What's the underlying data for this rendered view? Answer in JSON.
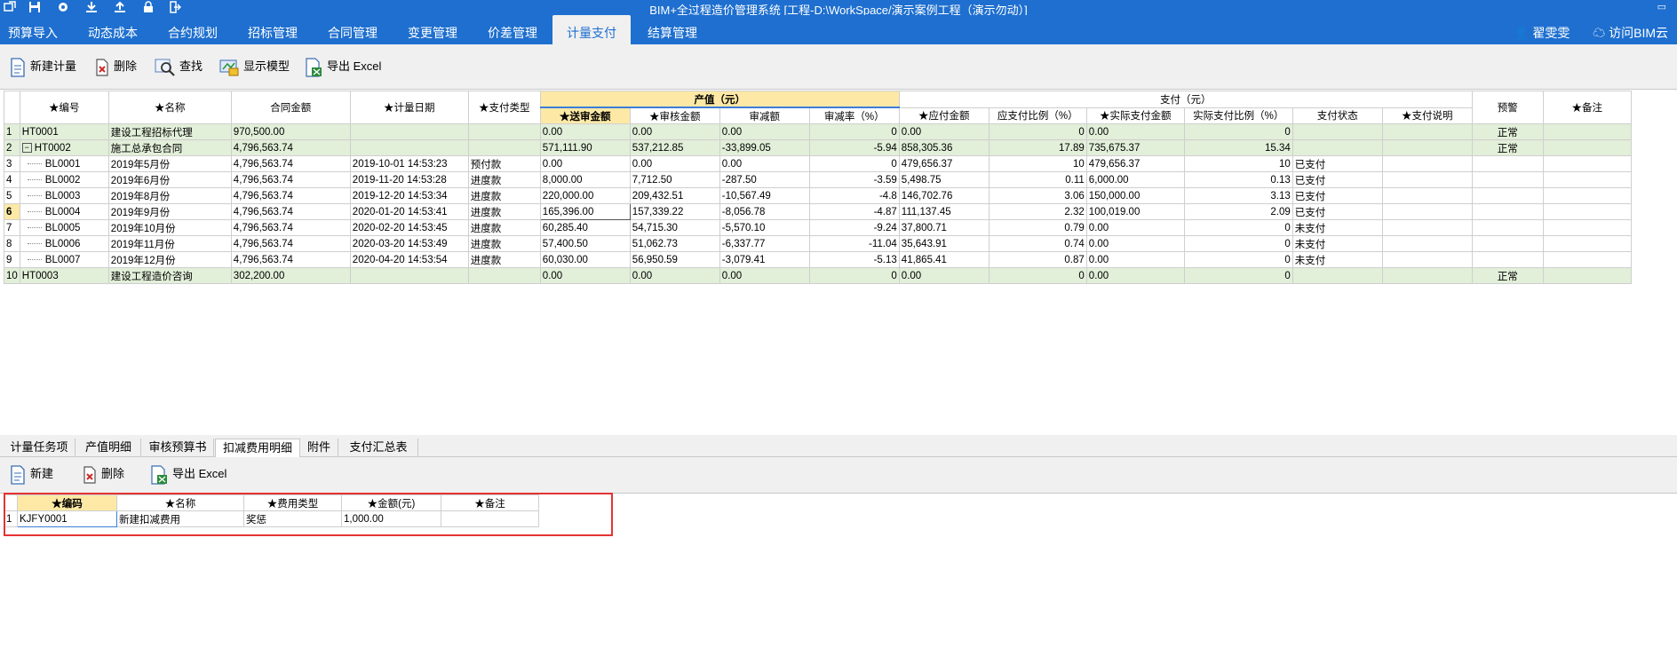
{
  "app": {
    "title": "BIM+全过程造价管理系统 [工程-D:\\WorkSpace/演示案例工程（演示勿动）]",
    "window_restore": "▭",
    "user_name": "翟雯雯",
    "cloud_link": "访问BIM云"
  },
  "menu": [
    {
      "label": "预算导入"
    },
    {
      "label": "动态成本"
    },
    {
      "label": "合约规划"
    },
    {
      "label": "招标管理"
    },
    {
      "label": "合同管理"
    },
    {
      "label": "变更管理"
    },
    {
      "label": "价差管理"
    },
    {
      "label": "计量支付"
    },
    {
      "label": "结算管理"
    }
  ],
  "toolbar": {
    "new_plan": "新建计量",
    "delete": "删除",
    "find": "查找",
    "show_model": "显示模型",
    "export_excel": "导出 Excel"
  },
  "main_table": {
    "group_output": "产值（元）",
    "group_payment": "支付（元）",
    "headers": [
      "★编号",
      "★名称",
      "合同金额",
      "★计量日期",
      "★支付类型",
      "★送审金额",
      "★审核金额",
      "审减额",
      "审减率（%）",
      "★应付金额",
      "应支付比例（%）",
      "★实际支付金额",
      "实际支付比例（%）",
      "支付状态",
      "★支付说明",
      "预警",
      "★备注"
    ],
    "rows": [
      {
        "n": "1",
        "code": "HT0001",
        "name": "建设工程招标代理",
        "amount": "970,500.00",
        "date": "",
        "type": "",
        "submit": "0.00",
        "audit": "0.00",
        "cut": "0.00",
        "rate": "0",
        "payable": "0.00",
        "pratio": "0",
        "actual": "0.00",
        "aratio": "0",
        "status": "",
        "note": "",
        "warn": "正常",
        "remark": ""
      },
      {
        "n": "2",
        "code": "HT0002",
        "name": "施工总承包合同",
        "amount": "4,796,563.74",
        "date": "",
        "type": "",
        "submit": "571,111.90",
        "audit": "537,212.85",
        "cut": "-33,899.05",
        "rate": "-5.94",
        "payable": "858,305.36",
        "pratio": "17.89",
        "actual": "735,675.37",
        "aratio": "15.34",
        "status": "",
        "note": "",
        "warn": "正常",
        "remark": ""
      },
      {
        "n": "3",
        "code": "BL0001",
        "name": "2019年5月份",
        "amount": "4,796,563.74",
        "date": "2019-10-01 14:53:23",
        "type": "预付款",
        "submit": "0.00",
        "audit": "0.00",
        "cut": "0.00",
        "rate": "0",
        "payable": "479,656.37",
        "pratio": "10",
        "actual": "479,656.37",
        "aratio": "10",
        "status": "已支付",
        "note": "",
        "warn": "",
        "remark": ""
      },
      {
        "n": "4",
        "code": "BL0002",
        "name": "2019年6月份",
        "amount": "4,796,563.74",
        "date": "2019-11-20 14:53:28",
        "type": "进度款",
        "submit": "8,000.00",
        "audit": "7,712.50",
        "cut": "-287.50",
        "rate": "-3.59",
        "payable": "5,498.75",
        "pratio": "0.11",
        "actual": "6,000.00",
        "aratio": "0.13",
        "status": "已支付",
        "note": "",
        "warn": "",
        "remark": ""
      },
      {
        "n": "5",
        "code": "BL0003",
        "name": "2019年8月份",
        "amount": "4,796,563.74",
        "date": "2019-12-20 14:53:34",
        "type": "进度款",
        "submit": "220,000.00",
        "audit": "209,432.51",
        "cut": "-10,567.49",
        "rate": "-4.8",
        "payable": "146,702.76",
        "pratio": "3.06",
        "actual": "150,000.00",
        "aratio": "3.13",
        "status": "已支付",
        "note": "",
        "warn": "",
        "remark": ""
      },
      {
        "n": "6",
        "code": "BL0004",
        "name": "2019年9月份",
        "amount": "4,796,563.74",
        "date": "2020-01-20 14:53:41",
        "type": "进度款",
        "submit": "165,396.00",
        "audit": "157,339.22",
        "cut": "-8,056.78",
        "rate": "-4.87",
        "payable": "111,137.45",
        "pratio": "2.32",
        "actual": "100,019.00",
        "aratio": "2.09",
        "status": "已支付",
        "note": "",
        "warn": "",
        "remark": ""
      },
      {
        "n": "7",
        "code": "BL0005",
        "name": "2019年10月份",
        "amount": "4,796,563.74",
        "date": "2020-02-20 14:53:45",
        "type": "进度款",
        "submit": "60,285.40",
        "audit": "54,715.30",
        "cut": "-5,570.10",
        "rate": "-9.24",
        "payable": "37,800.71",
        "pratio": "0.79",
        "actual": "0.00",
        "aratio": "0",
        "status": "未支付",
        "note": "",
        "warn": "",
        "remark": ""
      },
      {
        "n": "8",
        "code": "BL0006",
        "name": "2019年11月份",
        "amount": "4,796,563.74",
        "date": "2020-03-20 14:53:49",
        "type": "进度款",
        "submit": "57,400.50",
        "audit": "51,062.73",
        "cut": "-6,337.77",
        "rate": "-11.04",
        "payable": "35,643.91",
        "pratio": "0.74",
        "actual": "0.00",
        "aratio": "0",
        "status": "未支付",
        "note": "",
        "warn": "",
        "remark": ""
      },
      {
        "n": "9",
        "code": "BL0007",
        "name": "2019年12月份",
        "amount": "4,796,563.74",
        "date": "2020-04-20 14:53:54",
        "type": "进度款",
        "submit": "60,030.00",
        "audit": "56,950.59",
        "cut": "-3,079.41",
        "rate": "-5.13",
        "payable": "41,865.41",
        "pratio": "0.87",
        "actual": "0.00",
        "aratio": "0",
        "status": "未支付",
        "note": "",
        "warn": "",
        "remark": ""
      },
      {
        "n": "10",
        "code": "HT0003",
        "name": "建设工程造价咨询",
        "amount": "302,200.00",
        "date": "",
        "type": "",
        "submit": "0.00",
        "audit": "0.00",
        "cut": "0.00",
        "rate": "0",
        "payable": "0.00",
        "pratio": "0",
        "actual": "0.00",
        "aratio": "0",
        "status": "",
        "note": "",
        "warn": "正常",
        "remark": ""
      }
    ],
    "tree_toggle": "−"
  },
  "tabs": [
    {
      "label": "计量任务项"
    },
    {
      "label": "产值明细"
    },
    {
      "label": "审核预算书"
    },
    {
      "label": "扣减费用明细"
    },
    {
      "label": "附件"
    },
    {
      "label": "支付汇总表"
    }
  ],
  "subtoolbar": {
    "new": "新建",
    "delete": "删除",
    "export_excel": "导出 Excel"
  },
  "sub_table": {
    "headers": [
      "★编码",
      "★名称",
      "★费用类型",
      "★金额(元)",
      "★备注"
    ],
    "rows": [
      {
        "n": "1",
        "code": "KJFY0001",
        "name": "新建扣减费用",
        "type": "奖惩",
        "amount": "1,000.00",
        "remark": ""
      }
    ]
  }
}
